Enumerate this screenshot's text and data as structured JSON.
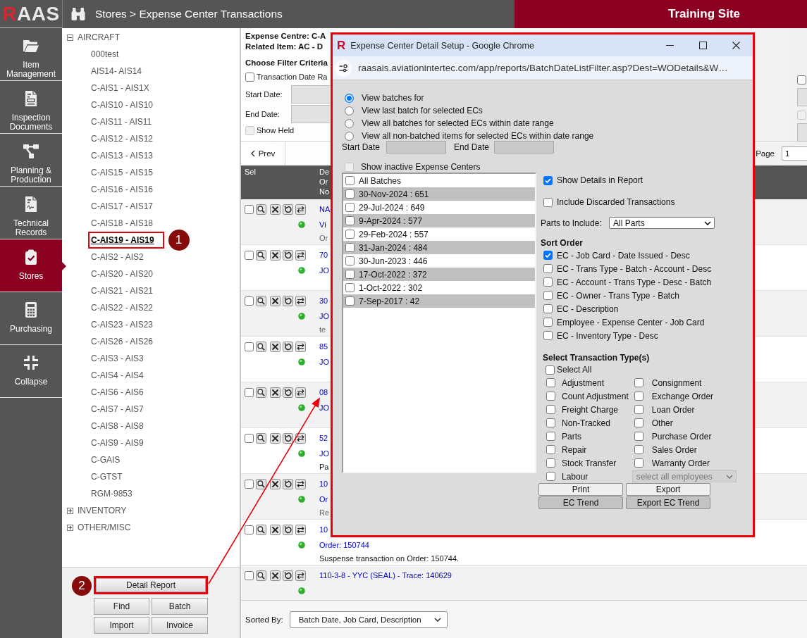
{
  "app": {
    "logo": "RAAS",
    "breadcrumb": "Stores > Expense Center Transactions",
    "site_banner": "Training Site",
    "annotation_arrow": true
  },
  "nav": [
    {
      "label": "Item Management",
      "selected": false
    },
    {
      "label": "Inspection Documents",
      "selected": false
    },
    {
      "label": "Planning & Production",
      "selected": false
    },
    {
      "label": "Technical Records",
      "selected": false
    },
    {
      "label": "Stores",
      "selected": true
    },
    {
      "label": "Purchasing",
      "selected": false
    },
    {
      "label": "Collapse",
      "selected": false
    }
  ],
  "tree": {
    "groups": [
      {
        "label": "AIRCRAFT",
        "expanded": true,
        "children": [
          {
            "label": "000test",
            "selected": false
          },
          {
            "label": "AIS14- AIS14",
            "selected": false
          },
          {
            "label": "C-AIS1 - AIS1X",
            "selected": false
          },
          {
            "label": "C-AIS10 - AIS10",
            "selected": false
          },
          {
            "label": "C-AIS11 - AIS11",
            "selected": false
          },
          {
            "label": "C-AIS12 - AIS12",
            "selected": false
          },
          {
            "label": "C-AIS13 - AIS13",
            "selected": false
          },
          {
            "label": "C-AIS15 - AIS15",
            "selected": false
          },
          {
            "label": "C-AIS16 - AIS16",
            "selected": false
          },
          {
            "label": "C-AIS17 - AIS17",
            "selected": false
          },
          {
            "label": "C-AIS18 - AIS18",
            "selected": false
          },
          {
            "label": "C-AIS19 - AIS19",
            "selected": true,
            "callout": "1"
          },
          {
            "label": "C-AIS2 - AIS2",
            "selected": false
          },
          {
            "label": "C-AIS20 - AIS20",
            "selected": false
          },
          {
            "label": "C-AIS21 - AIS21",
            "selected": false
          },
          {
            "label": "C-AIS22 - AIS22",
            "selected": false
          },
          {
            "label": "C-AIS23 - AIS23",
            "selected": false
          },
          {
            "label": "C-AIS26 - AIS26",
            "selected": false
          },
          {
            "label": "C-AIS3 - AIS3",
            "selected": false
          },
          {
            "label": "C-AIS4 - AIS4",
            "selected": false
          },
          {
            "label": "C-AIS6 - AIS6",
            "selected": false
          },
          {
            "label": "C-AIS7 - AIS7",
            "selected": false
          },
          {
            "label": "C-AIS8 - AIS8",
            "selected": false
          },
          {
            "label": "C-AIS9 - AIS9",
            "selected": false
          },
          {
            "label": "C-GAIS",
            "selected": false
          },
          {
            "label": "C-GTST",
            "selected": false
          },
          {
            "label": "RGM-9853",
            "selected": false
          }
        ]
      },
      {
        "label": "INVENTORY",
        "expanded": false
      },
      {
        "label": "OTHER/MISC",
        "expanded": false
      }
    ],
    "buttons": [
      {
        "label": "Detail Report",
        "callout": "2"
      },
      {
        "label": "Find"
      },
      {
        "label": "Batch"
      },
      {
        "label": "Import"
      },
      {
        "label": "Invoice"
      }
    ]
  },
  "main": {
    "info": [
      "Expense Centre: C-A",
      "Related Item: AC - D"
    ],
    "filter_title": "Choose Filter Criteria",
    "date_range": {
      "label": "Transaction Date Ra",
      "checked": false
    },
    "start_date": {
      "label": "Start Date:"
    },
    "end_date": {
      "label": "End Date:"
    },
    "show_held": {
      "label": "Show Held",
      "checked": false,
      "disabled": true
    },
    "side_controls": [
      {
        "kind": "checkbox",
        "checked": false,
        "disabled": false
      },
      {
        "kind": "field"
      },
      {
        "kind": "checkbox",
        "checked": false,
        "disabled": true
      },
      {
        "kind": "field"
      }
    ],
    "pager": {
      "prev": "Prev",
      "page_label": "Page",
      "page": "1"
    },
    "columns": [
      {
        "lines": [
          "Sel"
        ]
      },
      {
        "lines": [
          "De",
          "Or",
          "No"
        ]
      }
    ],
    "rows": [
      {
        "checked": false,
        "lines": [
          {
            "kind": "link",
            "text": "NA"
          },
          {
            "kind": "link",
            "text": "Vi"
          },
          {
            "kind": "note",
            "text": "Or"
          }
        ]
      },
      {
        "checked": false,
        "lines": [
          {
            "kind": "link",
            "text": "70"
          },
          {
            "kind": "link",
            "text": "JO"
          }
        ]
      },
      {
        "checked": false,
        "lines": [
          {
            "kind": "link",
            "text": "30"
          },
          {
            "kind": "link",
            "text": "JO"
          },
          {
            "kind": "note",
            "text": "te"
          }
        ]
      },
      {
        "checked": false,
        "lines": [
          {
            "kind": "link",
            "text": "85"
          },
          {
            "kind": "link",
            "text": "JO"
          }
        ]
      },
      {
        "checked": false,
        "lines": [
          {
            "kind": "link",
            "text": "08"
          },
          {
            "kind": "link",
            "text": "JO"
          }
        ]
      },
      {
        "checked": false,
        "lines": [
          {
            "kind": "link",
            "text": "52"
          },
          {
            "kind": "link",
            "text": "JO"
          },
          {
            "kind": "text",
            "text": "Pa"
          }
        ]
      },
      {
        "checked": false,
        "lines": [
          {
            "kind": "link",
            "text": "10"
          },
          {
            "kind": "link",
            "text": "Or"
          },
          {
            "kind": "note",
            "text": "Re"
          }
        ]
      },
      {
        "checked": false,
        "lines": [
          {
            "kind": "link",
            "text": "10"
          },
          {
            "kind": "link",
            "text": "Order: 150744"
          },
          {
            "kind": "text",
            "text": "Suspense transaction on Order: 150744."
          }
        ]
      },
      {
        "checked": false,
        "lines": [
          {
            "kind": "link",
            "text": "110-3-8 - YYC (SEAL) - Trace: 140629"
          }
        ]
      }
    ],
    "sorted_by": {
      "label": "Sorted By:",
      "value": "Batch Date, Job Card, Description"
    }
  },
  "popup": {
    "highlighted": true,
    "logo_mark": "R",
    "title": "Expense Center Detail Setup - Google Chrome",
    "url": "raasais.aviationintertec.com/app/reports/BatchDateListFilter.asp?Dest=WODetails&W…",
    "view_modes": [
      {
        "label": "View batches for",
        "selected": true
      },
      {
        "label": "View last batch for selected ECs",
        "selected": false
      },
      {
        "label": "View all batches for selected ECs within date range",
        "selected": false
      },
      {
        "label": "View all non-batched items for selected ECs within date range",
        "selected": false
      }
    ],
    "start_date": {
      "label": "Start Date"
    },
    "end_date": {
      "label": "End Date"
    },
    "show_inactive": {
      "label": "Show inactive Expense Centers",
      "checked": false,
      "disabled": true
    },
    "batches": [
      {
        "label": "All Batches",
        "checked": false
      },
      {
        "label": "30-Nov-2024 : 651",
        "checked": false
      },
      {
        "label": "29-Jul-2024 : 649",
        "checked": false
      },
      {
        "label": "9-Apr-2024 : 577",
        "checked": false
      },
      {
        "label": "29-Feb-2024 : 557",
        "checked": false
      },
      {
        "label": "31-Jan-2024 : 484",
        "checked": false
      },
      {
        "label": "30-Jun-2023 : 446",
        "checked": false
      },
      {
        "label": "17-Oct-2022 : 372",
        "checked": false
      },
      {
        "label": "1-Oct-2022 : 302",
        "checked": false
      },
      {
        "label": "7-Sep-2017 : 42",
        "checked": false
      }
    ],
    "report_options": [
      {
        "label": "Show Details in Report",
        "checked": true
      },
      {
        "label": "Include Discarded Transactions",
        "checked": false
      }
    ],
    "parts": {
      "label": "Parts to Include:",
      "value": "All Parts"
    },
    "sort_order": {
      "title": "Sort Order",
      "options": [
        {
          "label": "EC - Job Card - Date Issued - Desc",
          "checked": true
        },
        {
          "label": "EC - Trans Type - Batch - Account - Desc",
          "checked": false
        },
        {
          "label": "EC - Account - Trans Type - Desc - Batch",
          "checked": false
        },
        {
          "label": "EC - Owner - Trans Type - Batch",
          "checked": false
        },
        {
          "label": "EC - Description",
          "checked": false
        },
        {
          "label": "Employee - Expense Center - Job Card",
          "checked": false
        },
        {
          "label": "EC - Inventory Type - Desc",
          "checked": false
        }
      ]
    },
    "transaction_types": {
      "title": "Select Transaction Type(s)",
      "select_all": {
        "label": "Select All",
        "checked": false
      },
      "types": [
        {
          "label": "Adjustment",
          "checked": false
        },
        {
          "label": "Consignment",
          "checked": false
        },
        {
          "label": "Count Adjustment",
          "checked": false
        },
        {
          "label": "Exchange Order",
          "checked": false
        },
        {
          "label": "Freight Charge",
          "checked": false
        },
        {
          "label": "Loan Order",
          "checked": false
        },
        {
          "label": "Non-Tracked",
          "checked": false
        },
        {
          "label": "Other",
          "checked": false
        },
        {
          "label": "Parts",
          "checked": false
        },
        {
          "label": "Purchase Order",
          "checked": false
        },
        {
          "label": "Repair",
          "checked": false
        },
        {
          "label": "Sales Order",
          "checked": false
        },
        {
          "label": "Stock Transfer",
          "checked": false
        },
        {
          "label": "Warranty Order",
          "checked": false
        },
        {
          "label": "Labour",
          "checked": false
        }
      ],
      "employees": {
        "value": "select all employees",
        "disabled": true
      }
    },
    "buttons": [
      {
        "label": "Print",
        "kind": "plain"
      },
      {
        "label": "Export",
        "kind": "plain"
      },
      {
        "label": "EC Trend",
        "kind": "shaded"
      },
      {
        "label": "Export EC Trend",
        "kind": "shaded"
      }
    ]
  }
}
